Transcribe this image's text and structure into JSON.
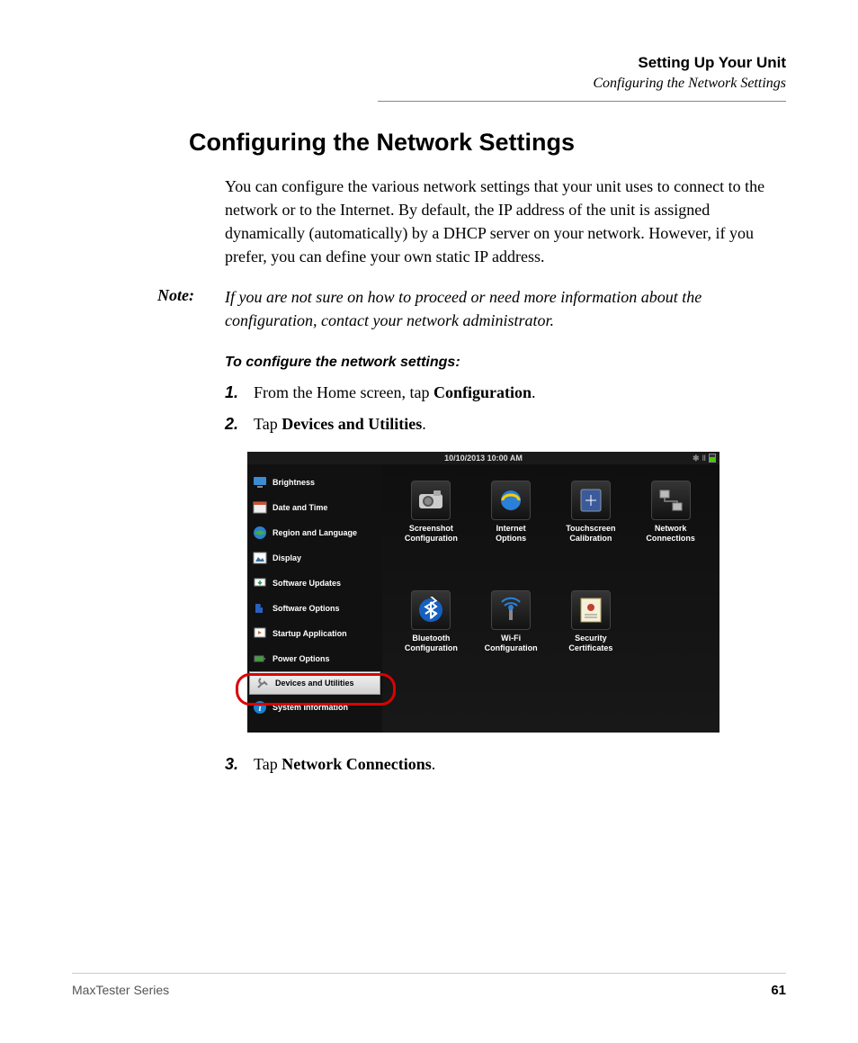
{
  "header": {
    "chapter": "Setting Up Your Unit",
    "section": "Configuring the Network Settings"
  },
  "heading": "Configuring the Network Settings",
  "intro": "You can configure the various network settings that your unit uses to connect to the network or to the Internet. By default, the IP address of the unit is assigned dynamically (automatically) by a DHCP server on your network. However, if you prefer, you can define your own static IP address.",
  "note": {
    "label": "Note:",
    "text": "If you are not sure on how to proceed or need more information about the configuration, contact your network administrator."
  },
  "procedure_heading": "To configure the network settings:",
  "steps": [
    {
      "num": "1.",
      "prefix": "From the Home screen, tap ",
      "bold": "Configuration",
      "suffix": "."
    },
    {
      "num": "2.",
      "prefix": "Tap ",
      "bold": "Devices and Utilities",
      "suffix": "."
    },
    {
      "num": "3.",
      "prefix": "Tap ",
      "bold": "Network Connections",
      "suffix": "."
    }
  ],
  "screenshot": {
    "timestamp": "10/10/2013 10:00 AM",
    "sidebar": [
      {
        "label": "Brightness",
        "icon": "monitor",
        "color": "#3a8cd4"
      },
      {
        "label": "Date and Time",
        "icon": "calendar",
        "color": "#d05030"
      },
      {
        "label": "Region and Language",
        "icon": "globe",
        "color": "#2a80d0"
      },
      {
        "label": "Display",
        "icon": "picture",
        "color": "#3b6fa0"
      },
      {
        "label": "Software Updates",
        "icon": "update",
        "color": "#2a9a4a"
      },
      {
        "label": "Software Options",
        "icon": "puzzle",
        "color": "#2a60c0"
      },
      {
        "label": "Startup Application",
        "icon": "startup",
        "color": "#d07030"
      },
      {
        "label": "Power Options",
        "icon": "battery",
        "color": "#40a040"
      },
      {
        "label": "Devices and Utilities",
        "icon": "tools",
        "color": "#a0a0a0",
        "selected": true
      },
      {
        "label": "System Information",
        "icon": "info",
        "color": "#1a80d0"
      }
    ],
    "tiles": [
      {
        "label": "Screenshot Configuration",
        "icon": "camera"
      },
      {
        "label": "Internet Options",
        "icon": "ie"
      },
      {
        "label": "Touchscreen Calibration",
        "icon": "touch"
      },
      {
        "label": "Network Connections",
        "icon": "network"
      },
      {
        "label": "Bluetooth Configuration",
        "icon": "bluetooth"
      },
      {
        "label": "Wi-Fi Configuration",
        "icon": "wifi"
      },
      {
        "label": "Security Certificates",
        "icon": "cert"
      },
      null
    ]
  },
  "footer": {
    "series": "MaxTester Series",
    "page": "61"
  }
}
